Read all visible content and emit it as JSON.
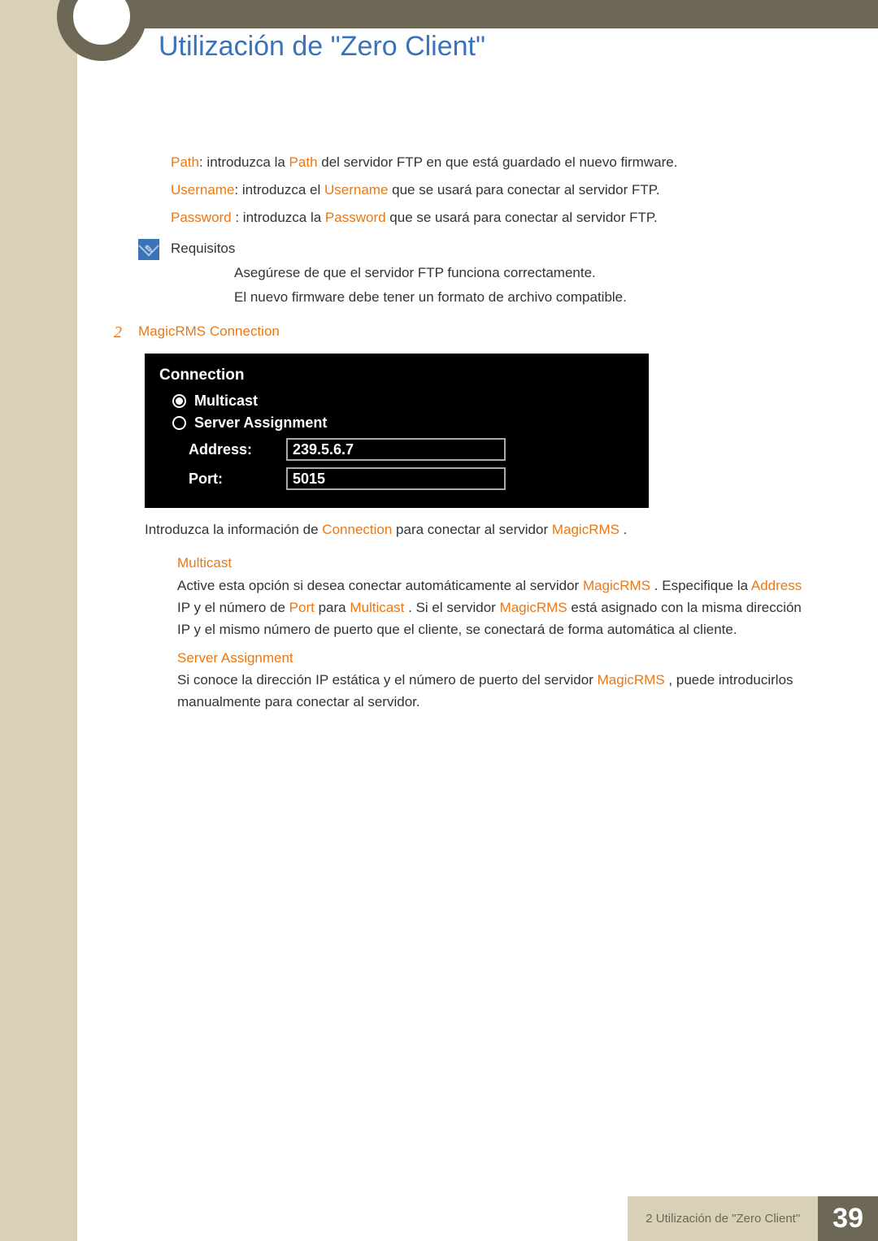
{
  "header": {
    "title": "Utilización de \"Zero Client\""
  },
  "bullets": {
    "path": {
      "term": "Path",
      "text": ": introduzca la ",
      "term2": "Path",
      "rest": " del servidor FTP en que está guardado el nuevo firmware."
    },
    "username": {
      "term": "Username",
      "text": ": introduzca el ",
      "term2": "Username",
      "rest": " que se usará para conectar al servidor FTP."
    },
    "password": {
      "term": "Password",
      "text": " : introduzca la ",
      "term2": "Password",
      "rest": "  que se usará para conectar al servidor FTP."
    }
  },
  "note": {
    "title": "Requisitos",
    "items": [
      "Asegúrese de que el servidor FTP funciona correctamente.",
      "El nuevo firmware debe tener un formato de archivo compatible."
    ]
  },
  "section2": {
    "num": "2",
    "title": "MagicRMS Connection"
  },
  "panel": {
    "title": "Connection",
    "multicast": "Multicast",
    "serverAssignment": "Server Assignment",
    "addressLabel": "Address:",
    "addressValue": "239.5.6.7",
    "portLabel": "Port:",
    "portValue": "5015"
  },
  "para1": {
    "t1": "Introduzca la información de ",
    "hl1": "Connection",
    "t2": "  para conectar al servidor ",
    "hl2": "MagicRMS",
    "t3": " ."
  },
  "multicast": {
    "title": "Multicast",
    "p1a": "Active esta opción si desea conectar automáticamente al servidor ",
    "hl1": "MagicRMS",
    "p1b": " . Especifique la ",
    "hl2": "Address",
    "p1c": " IP y el número de ",
    "hl3": "Port",
    "p1d": " para ",
    "hl4": "Multicast",
    "p1e": " . Si el servidor ",
    "hl5": "MagicRMS",
    "p1f": "  está asignado con la misma dirección IP y el mismo número de puerto que el cliente, se conectará de forma automática al cliente."
  },
  "serverAssign": {
    "title": "Server Assignment",
    "p1a": "Si conoce la dirección IP estática y el número de puerto del servidor ",
    "hl1": "MagicRMS",
    "p1b": " , puede introducirlos manualmente para conectar al servidor."
  },
  "footer": {
    "text": "2 Utilización de \"Zero Client\"",
    "page": "39"
  },
  "bulletGlyph": "",
  "chart_data": {
    "type": "table",
    "title": "Connection",
    "rows": [
      {
        "field": "Multicast",
        "selected": true
      },
      {
        "field": "Server Assignment",
        "selected": false
      },
      {
        "field": "Address",
        "value": "239.5.6.7"
      },
      {
        "field": "Port",
        "value": "5015"
      }
    ]
  }
}
